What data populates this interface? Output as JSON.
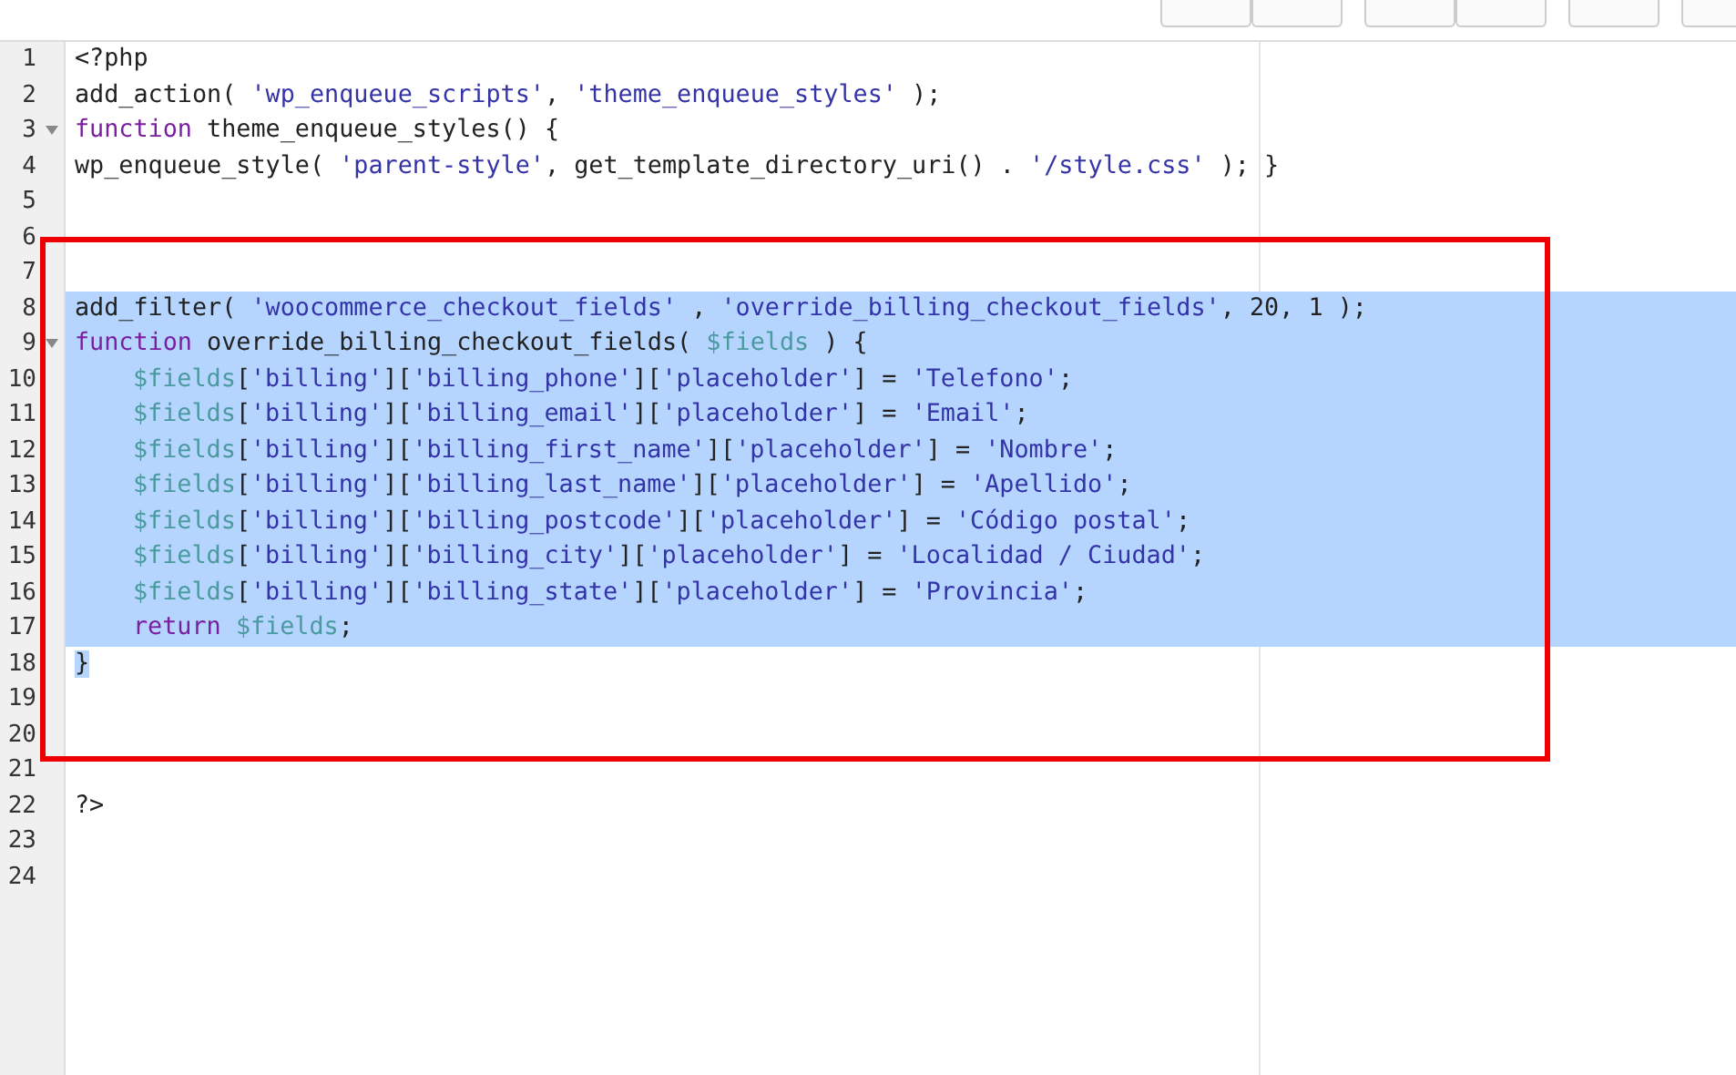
{
  "editor": {
    "lines": [
      {
        "number": "1",
        "foldable": false,
        "selected": false,
        "indented": false,
        "tokens": [
          {
            "text": "<?php",
            "kind": "plain"
          }
        ]
      },
      {
        "number": "2",
        "foldable": false,
        "selected": false,
        "indented": false,
        "tokens": [
          {
            "text": "add_action( ",
            "kind": "plain"
          },
          {
            "text": "'wp_enqueue_scripts'",
            "kind": "string"
          },
          {
            "text": ", ",
            "kind": "plain"
          },
          {
            "text": "'theme_enqueue_styles'",
            "kind": "string"
          },
          {
            "text": " );",
            "kind": "plain"
          }
        ]
      },
      {
        "number": "3",
        "foldable": true,
        "selected": false,
        "indented": false,
        "tokens": [
          {
            "text": "function",
            "kind": "keyword"
          },
          {
            "text": " theme_enqueue_styles() {",
            "kind": "plain"
          }
        ]
      },
      {
        "number": "4",
        "foldable": false,
        "selected": false,
        "indented": false,
        "tokens": [
          {
            "text": "wp_enqueue_style( ",
            "kind": "plain"
          },
          {
            "text": "'parent-style'",
            "kind": "string"
          },
          {
            "text": ", get_template_directory_uri() . ",
            "kind": "plain"
          },
          {
            "text": "'/style.css'",
            "kind": "string"
          },
          {
            "text": " ); }",
            "kind": "plain"
          }
        ]
      },
      {
        "number": "5",
        "foldable": false,
        "selected": false
      },
      {
        "number": "6",
        "foldable": false,
        "selected": false
      },
      {
        "number": "7",
        "foldable": false,
        "selected": false
      },
      {
        "number": "8",
        "foldable": false,
        "selected": true,
        "indented": false,
        "tokens": [
          {
            "text": "add_filter( ",
            "kind": "plain"
          },
          {
            "text": "'woocommerce_checkout_fields'",
            "kind": "string"
          },
          {
            "text": " , ",
            "kind": "plain"
          },
          {
            "text": "'override_billing_checkout_fields'",
            "kind": "string"
          },
          {
            "text": ", 20, 1 );",
            "kind": "plain"
          }
        ]
      },
      {
        "number": "9",
        "foldable": true,
        "selected": true,
        "indented": false,
        "tokens": [
          {
            "text": "function",
            "kind": "keyword"
          },
          {
            "text": " override_billing_checkout_fields( ",
            "kind": "plain"
          },
          {
            "text": "$fields",
            "kind": "variable"
          },
          {
            "text": " ) {",
            "kind": "plain"
          }
        ]
      },
      {
        "number": "10",
        "foldable": false,
        "selected": true,
        "indented": true,
        "tokens": [
          {
            "text": "$fields",
            "kind": "variable"
          },
          {
            "text": "[",
            "kind": "plain"
          },
          {
            "text": "'billing'",
            "kind": "string"
          },
          {
            "text": "][",
            "kind": "plain"
          },
          {
            "text": "'billing_phone'",
            "kind": "string"
          },
          {
            "text": "][",
            "kind": "plain"
          },
          {
            "text": "'placeholder'",
            "kind": "string"
          },
          {
            "text": "] = ",
            "kind": "plain"
          },
          {
            "text": "'Telefono'",
            "kind": "string"
          },
          {
            "text": ";",
            "kind": "plain"
          }
        ]
      },
      {
        "number": "11",
        "foldable": false,
        "selected": true,
        "indented": true,
        "tokens": [
          {
            "text": "$fields",
            "kind": "variable"
          },
          {
            "text": "[",
            "kind": "plain"
          },
          {
            "text": "'billing'",
            "kind": "string"
          },
          {
            "text": "][",
            "kind": "plain"
          },
          {
            "text": "'billing_email'",
            "kind": "string"
          },
          {
            "text": "][",
            "kind": "plain"
          },
          {
            "text": "'placeholder'",
            "kind": "string"
          },
          {
            "text": "] = ",
            "kind": "plain"
          },
          {
            "text": "'Email'",
            "kind": "string"
          },
          {
            "text": ";",
            "kind": "plain"
          }
        ]
      },
      {
        "number": "12",
        "foldable": false,
        "selected": true,
        "indented": true,
        "tokens": [
          {
            "text": "$fields",
            "kind": "variable"
          },
          {
            "text": "[",
            "kind": "plain"
          },
          {
            "text": "'billing'",
            "kind": "string"
          },
          {
            "text": "][",
            "kind": "plain"
          },
          {
            "text": "'billing_first_name'",
            "kind": "string"
          },
          {
            "text": "][",
            "kind": "plain"
          },
          {
            "text": "'placeholder'",
            "kind": "string"
          },
          {
            "text": "] = ",
            "kind": "plain"
          },
          {
            "text": "'Nombre'",
            "kind": "string"
          },
          {
            "text": ";",
            "kind": "plain"
          }
        ]
      },
      {
        "number": "13",
        "foldable": false,
        "selected": true,
        "indented": true,
        "tokens": [
          {
            "text": "$fields",
            "kind": "variable"
          },
          {
            "text": "[",
            "kind": "plain"
          },
          {
            "text": "'billing'",
            "kind": "string"
          },
          {
            "text": "][",
            "kind": "plain"
          },
          {
            "text": "'billing_last_name'",
            "kind": "string"
          },
          {
            "text": "][",
            "kind": "plain"
          },
          {
            "text": "'placeholder'",
            "kind": "string"
          },
          {
            "text": "] = ",
            "kind": "plain"
          },
          {
            "text": "'Apellido'",
            "kind": "string"
          },
          {
            "text": ";",
            "kind": "plain"
          }
        ]
      },
      {
        "number": "14",
        "foldable": false,
        "selected": true,
        "indented": true,
        "tokens": [
          {
            "text": "$fields",
            "kind": "variable"
          },
          {
            "text": "[",
            "kind": "plain"
          },
          {
            "text": "'billing'",
            "kind": "string"
          },
          {
            "text": "][",
            "kind": "plain"
          },
          {
            "text": "'billing_postcode'",
            "kind": "string"
          },
          {
            "text": "][",
            "kind": "plain"
          },
          {
            "text": "'placeholder'",
            "kind": "string"
          },
          {
            "text": "] = ",
            "kind": "plain"
          },
          {
            "text": "'Código postal'",
            "kind": "string"
          },
          {
            "text": ";",
            "kind": "plain"
          }
        ]
      },
      {
        "number": "15",
        "foldable": false,
        "selected": true,
        "indented": true,
        "tokens": [
          {
            "text": "$fields",
            "kind": "variable"
          },
          {
            "text": "[",
            "kind": "plain"
          },
          {
            "text": "'billing'",
            "kind": "string"
          },
          {
            "text": "][",
            "kind": "plain"
          },
          {
            "text": "'billing_city'",
            "kind": "string"
          },
          {
            "text": "][",
            "kind": "plain"
          },
          {
            "text": "'placeholder'",
            "kind": "string"
          },
          {
            "text": "] = ",
            "kind": "plain"
          },
          {
            "text": "'Localidad / Ciudad'",
            "kind": "string"
          },
          {
            "text": ";",
            "kind": "plain"
          }
        ]
      },
      {
        "number": "16",
        "foldable": false,
        "selected": true,
        "indented": true,
        "tokens": [
          {
            "text": "$fields",
            "kind": "variable"
          },
          {
            "text": "[",
            "kind": "plain"
          },
          {
            "text": "'billing'",
            "kind": "string"
          },
          {
            "text": "][",
            "kind": "plain"
          },
          {
            "text": "'billing_state'",
            "kind": "string"
          },
          {
            "text": "][",
            "kind": "plain"
          },
          {
            "text": "'placeholder'",
            "kind": "string"
          },
          {
            "text": "] = ",
            "kind": "plain"
          },
          {
            "text": "'Provincia'",
            "kind": "string"
          },
          {
            "text": ";",
            "kind": "plain"
          }
        ]
      },
      {
        "number": "17",
        "foldable": false,
        "selected": true,
        "indented": true,
        "tokens": [
          {
            "text": "return ",
            "kind": "keyword"
          },
          {
            "text": "$fields",
            "kind": "variable"
          },
          {
            "text": ";",
            "kind": "plain"
          }
        ]
      },
      {
        "number": "18",
        "foldable": false,
        "selected": false,
        "indented": false,
        "tokens": [
          {
            "text": "}",
            "kind": "plain",
            "selected": true
          }
        ]
      },
      {
        "number": "19",
        "foldable": false,
        "selected": false
      },
      {
        "number": "20",
        "foldable": false,
        "selected": false
      },
      {
        "number": "21",
        "foldable": false,
        "selected": false
      },
      {
        "number": "22",
        "foldable": false,
        "selected": false,
        "indented": false,
        "tokens": [
          {
            "text": "?>",
            "kind": "plain"
          }
        ]
      },
      {
        "number": "23",
        "foldable": false,
        "selected": false
      },
      {
        "number": "24",
        "foldable": false,
        "selected": false
      }
    ]
  },
  "annotation": {
    "kind": "frame",
    "color": "#ee0000"
  }
}
